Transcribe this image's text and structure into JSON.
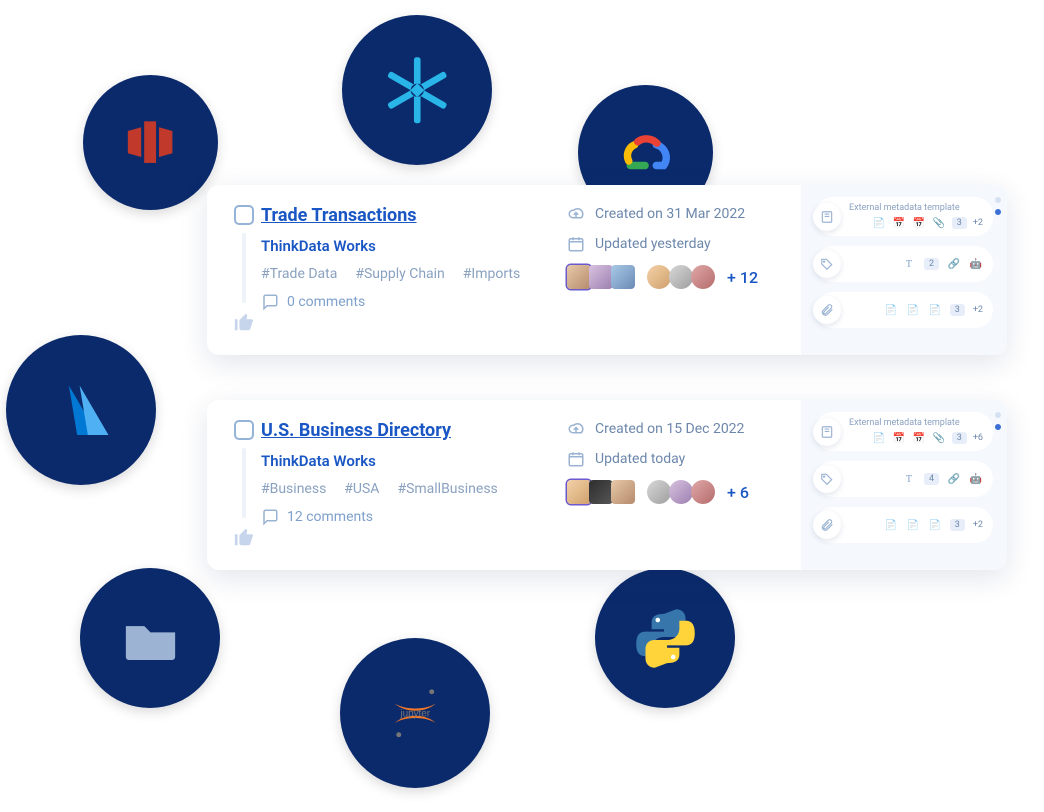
{
  "integrations": [
    {
      "id": "redshift",
      "label": "Redshift"
    },
    {
      "id": "snowflake",
      "label": "Snowflake"
    },
    {
      "id": "gcp",
      "label": "Google Cloud"
    },
    {
      "id": "azure",
      "label": "Azure"
    },
    {
      "id": "files",
      "label": "Files"
    },
    {
      "id": "jupyter",
      "label": "Jupyter"
    },
    {
      "id": "python",
      "label": "Python"
    }
  ],
  "cards": [
    {
      "title": "Trade Transactions",
      "org": "ThinkData Works",
      "tags": [
        "#Trade Data",
        "#Supply Chain",
        "#Imports"
      ],
      "comments": "0 comments",
      "created": "Created on 31 Mar 2022",
      "updated": "Updated yesterday",
      "more_people": "+ 12",
      "side": {
        "meta_label": "External metadata template",
        "meta_badge": "3",
        "meta_plus": "+2",
        "type_badge": "2",
        "attach_badge": "3",
        "attach_plus": "+2"
      }
    },
    {
      "title": "U.S. Business Directory",
      "org": "ThinkData Works",
      "tags": [
        "#Business",
        "#USA",
        "#SmallBusiness"
      ],
      "comments": "12 comments",
      "created": "Created on 15 Dec 2022",
      "updated": "Updated today",
      "more_people": "+ 6",
      "side": {
        "meta_label": "External metadata template",
        "meta_badge": "3",
        "meta_plus": "+6",
        "type_badge": "4",
        "attach_badge": "3",
        "attach_plus": "+2"
      }
    }
  ]
}
